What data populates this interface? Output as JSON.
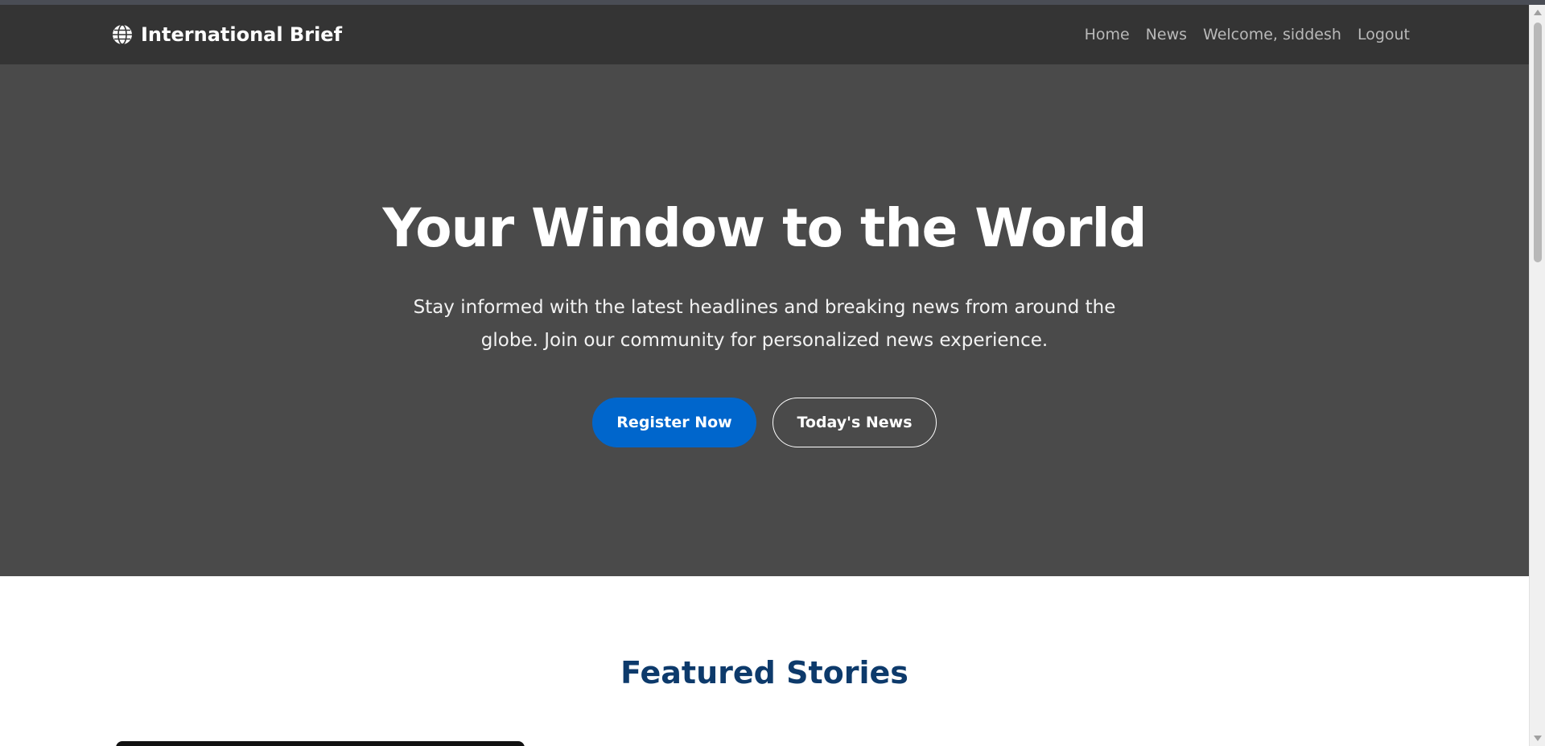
{
  "navbar": {
    "brand_icon": "globe-icon",
    "brand_text": "International Brief",
    "links": [
      "Home",
      "News",
      "Welcome, siddesh",
      "Logout"
    ]
  },
  "hero": {
    "title": "Your Window to the World",
    "subtitle": "Stay informed with the latest headlines and breaking news from around the globe. Join our community for personalized news experience.",
    "primary_button": "Register Now",
    "secondary_button": "Today's News"
  },
  "featured": {
    "title": "Featured Stories"
  },
  "colors": {
    "navbar_bg": "#343434",
    "hero_bg": "#4a4a4a",
    "primary_button": "#0066cc",
    "featured_title": "#0d3a6b"
  }
}
